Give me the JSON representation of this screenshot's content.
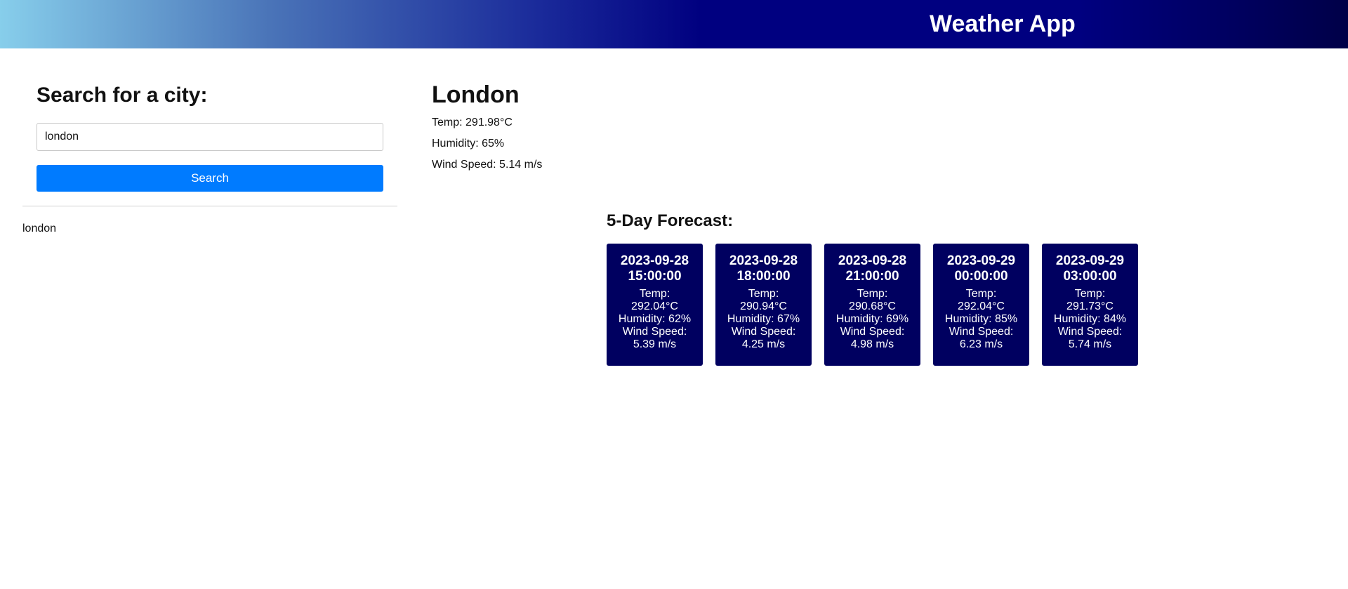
{
  "header": {
    "title": "Weather App"
  },
  "search": {
    "heading": "Search for a city:",
    "input_value": "london",
    "button_label": "Search"
  },
  "history": [
    "london"
  ],
  "current": {
    "city": "London",
    "temp": "Temp: 291.98°C",
    "humidity": "Humidity: 65%",
    "wind": "Wind Speed: 5.14 m/s"
  },
  "forecast": {
    "heading": "5-Day Forecast:",
    "days": [
      {
        "date": "2023-09-28",
        "time": "15:00:00",
        "temp_label": "Temp:",
        "temp": "292.04°C",
        "humidity": "Humidity: 62%",
        "wind_label": "Wind Speed:",
        "wind": "5.39 m/s"
      },
      {
        "date": "2023-09-28",
        "time": "18:00:00",
        "temp_label": "Temp:",
        "temp": "290.94°C",
        "humidity": "Humidity: 67%",
        "wind_label": "Wind Speed:",
        "wind": "4.25 m/s"
      },
      {
        "date": "2023-09-28",
        "time": "21:00:00",
        "temp_label": "Temp:",
        "temp": "290.68°C",
        "humidity": "Humidity: 69%",
        "wind_label": "Wind Speed:",
        "wind": "4.98 m/s"
      },
      {
        "date": "2023-09-29",
        "time": "00:00:00",
        "temp_label": "Temp:",
        "temp": "292.04°C",
        "humidity": "Humidity: 85%",
        "wind_label": "Wind Speed:",
        "wind": "6.23 m/s"
      },
      {
        "date": "2023-09-29",
        "time": "03:00:00",
        "temp_label": "Temp:",
        "temp": "291.73°C",
        "humidity": "Humidity: 84%",
        "wind_label": "Wind Speed:",
        "wind": "5.74 m/s"
      }
    ]
  },
  "colors": {
    "header_gradient_start": "#87ceeb",
    "header_gradient_mid": "#000080",
    "header_gradient_end": "#000048",
    "button": "#007bff",
    "card_bg": "#000060"
  }
}
